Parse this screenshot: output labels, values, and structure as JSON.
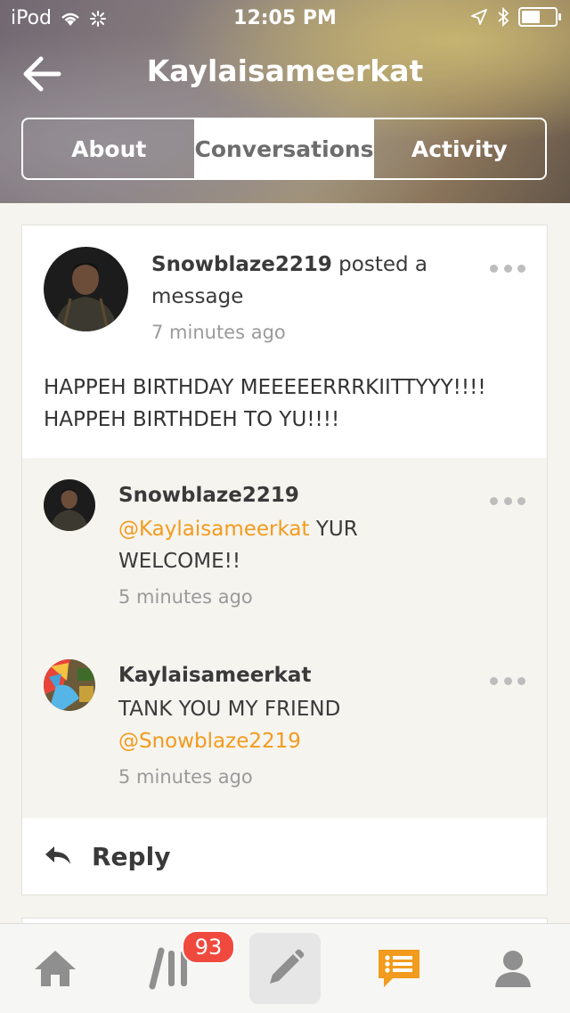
{
  "status_bar": {
    "carrier": "iPod",
    "time": "12:05 PM",
    "battery_level": 0.5
  },
  "header": {
    "title": "Kaylaisameerkat",
    "tabs": [
      {
        "label": "About",
        "active": false
      },
      {
        "label": "Conversations",
        "active": true
      },
      {
        "label": "Activity",
        "active": false
      }
    ]
  },
  "post": {
    "author": "Snowblaze2219",
    "action": "posted a message",
    "time": "7 minutes ago",
    "body_line1": "HAPPEH BIRTHDAY MEEEEERRRKIITTYYY!!!!",
    "body_line2": "HAPPEH BIRTHDEH TO YU!!!!"
  },
  "replies": [
    {
      "author": "Snowblaze2219",
      "mention": "@Kaylaisameerkat",
      "text": "YUR WELCOME!!",
      "time": "5 minutes ago"
    },
    {
      "author": "Kaylaisameerkat",
      "text": "TANK YOU MY FRIEND",
      "mention": "@Snowblaze2219",
      "time": "5 minutes ago"
    }
  ],
  "reply_button": {
    "label": "Reply"
  },
  "nav": {
    "badge_count": "93",
    "items": [
      "home-icon",
      "library-icon",
      "compose-icon",
      "conversations-icon",
      "profile-icon"
    ],
    "accent_color": "#f29b1e"
  },
  "colors": {
    "accent": "#f29b1e",
    "badge": "#f04a3f",
    "background": "#f6f4ef"
  }
}
